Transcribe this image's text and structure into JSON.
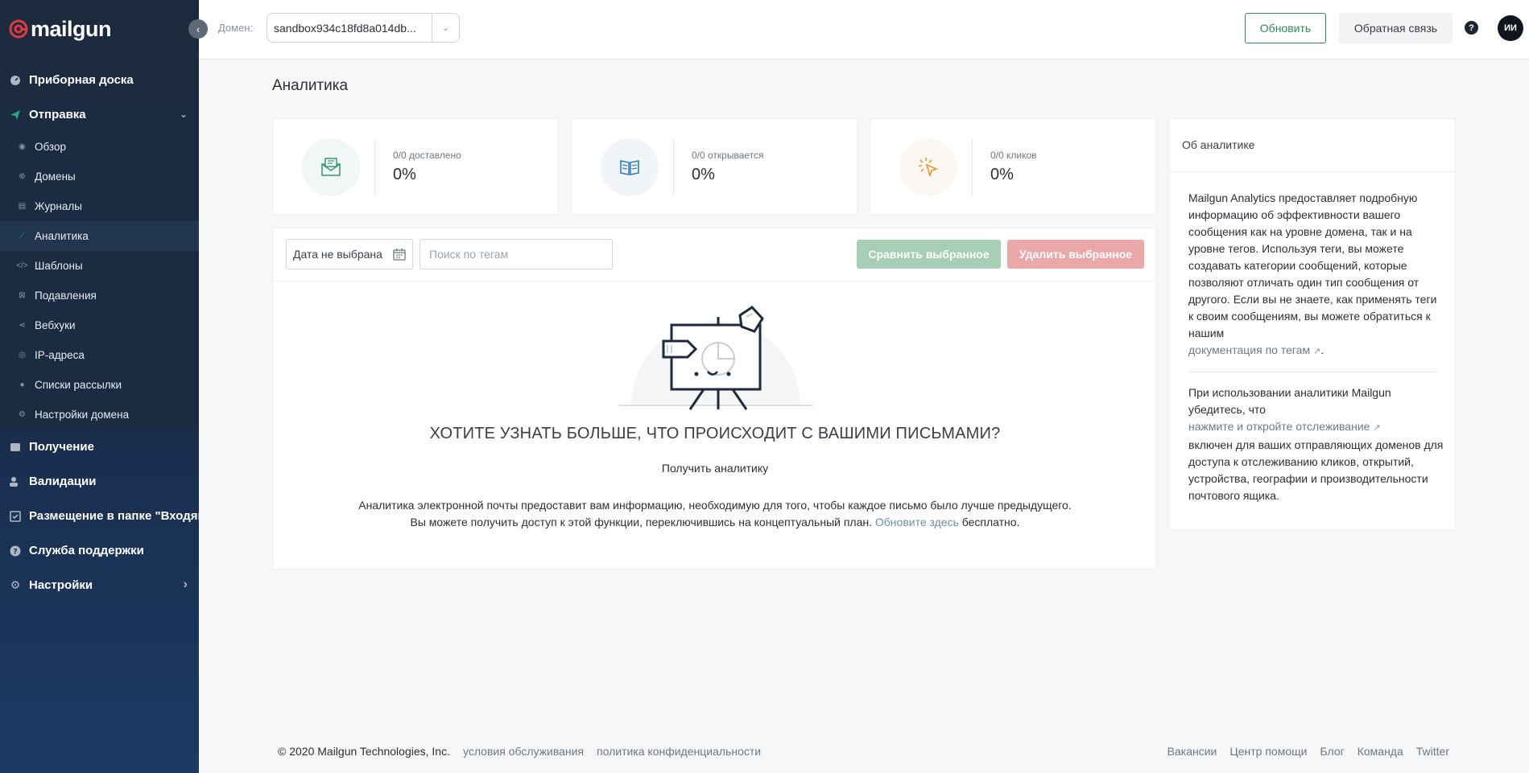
{
  "sidebar": {
    "logo_text": "mailgun",
    "items": [
      {
        "label": "Приборная доска",
        "icon": "gauge-icon"
      },
      {
        "label": "Отправка",
        "icon": "send-icon"
      },
      {
        "label": "Получение",
        "icon": "inbox-icon"
      },
      {
        "label": "Валидации",
        "icon": "user-check-icon"
      },
      {
        "label": "Размещение в папке \"Входящие\"",
        "icon": "check-square-icon"
      },
      {
        "label": "Служба поддержки",
        "icon": "help-icon"
      },
      {
        "label": "Настройки",
        "icon": "gear-icon"
      }
    ],
    "sending_sub": [
      {
        "label": "Обзор",
        "icon": "eye-icon"
      },
      {
        "label": "Домены",
        "icon": "globe-icon"
      },
      {
        "label": "Журналы",
        "icon": "log-icon"
      },
      {
        "label": "Аналитика",
        "icon": "analytics-icon"
      },
      {
        "label": "Шаблоны",
        "icon": "code-icon"
      },
      {
        "label": "Подавления",
        "icon": "block-icon"
      },
      {
        "label": "Вебхуки",
        "icon": "share-icon"
      },
      {
        "label": "IP-адреса",
        "icon": "pin-icon"
      },
      {
        "label": "Списки рассылки",
        "icon": "person-icon"
      },
      {
        "label": "Настройки домена",
        "icon": "gear-icon"
      }
    ],
    "colors": {
      "bg_top": "#1c2a3d",
      "bg_bottom": "#1a3a64",
      "accent": "#25a67a"
    }
  },
  "topbar": {
    "domain_label": "Домен:",
    "domain_value": "sandbox934c18fd8a014db...",
    "update_label": "Обновить",
    "feedback_label": "Обратная связь",
    "help_label": "?",
    "avatar_initials": "ИИ"
  },
  "main": {
    "title": "Аналитика",
    "stats": [
      {
        "label": "0/0 доставлено",
        "value": "0%",
        "icon": "envelope-icon"
      },
      {
        "label": "0/0 открывается",
        "value": "0%",
        "icon": "open-book-icon"
      },
      {
        "label": "0/0 кликов",
        "value": "0%",
        "icon": "cursor-click-icon"
      }
    ],
    "date_placeholder": "Дата не выбрана",
    "tag_search_placeholder": "Поиск по тегам",
    "compare_label": "Сравнить выбранное",
    "delete_label": "Удалить выбранное",
    "empty": {
      "headline": "ХОТИТЕ УЗНАТЬ БОЛЬШЕ, ЧТО ПРОИСХОДИТ С ВАШИМИ ПИСЬМАМИ?",
      "sub": "Получить аналитику",
      "desc_line1": "Аналитика электронной почты предоставит вам информацию, необходимую для того, чтобы каждое письмо было лучше предыдущего.",
      "desc_line2_pre": "Вы можете получить доступ к этой функции, переключившись на концептуальный план.",
      "desc_link": "Обновите здесь",
      "desc_line2_post": "бесплатно."
    }
  },
  "about": {
    "title": "Об аналитике",
    "p1": "Mailgun Analytics предоставляет подробную информацию об эффективности вашего сообщения как на уровне домена, так и на уровне тегов. Используя теги, вы можете создавать категории сообщений, которые позволяют отличать один тип сообщения от другого. Если вы не знаете, как применять теги к своим сообщениям, вы можете обратиться к нашим",
    "p1_link": "документация по тегам",
    "p2_pre": "При использовании аналитики Mailgun убедитесь, что",
    "p2_link": "нажмите и откройте отслеживание",
    "p2_post": "включен для ваших отправляющих доменов для доступа к отслеживанию кликов, открытий, устройства, географии и производительности почтового ящика."
  },
  "footer": {
    "copyright": "© 2020 Mailgun Technologies, Inc.",
    "terms": "условия обслуживания",
    "privacy": "политика конфиденциальности",
    "links": [
      "Вакансии",
      "Центр помощи",
      "Блог",
      "Команда",
      "Twitter"
    ]
  }
}
